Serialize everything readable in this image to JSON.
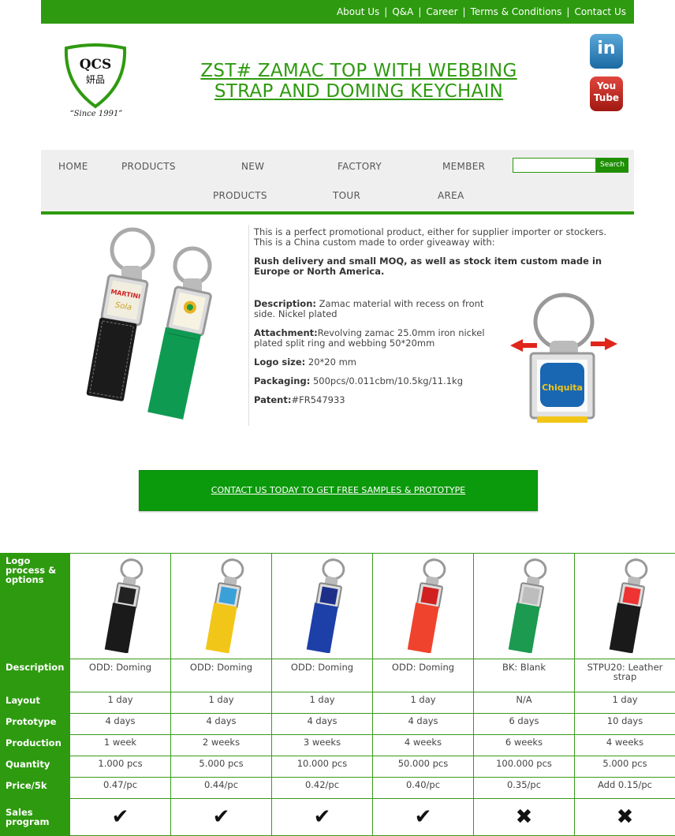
{
  "topnav": {
    "links": [
      "About Us",
      "Q&A",
      "Career",
      "Terms & Conditions",
      "Contact Us"
    ],
    "separator": "|"
  },
  "logo": {
    "text_top": "QCS",
    "text_bottom": "妍品",
    "since": "“Since 1991”"
  },
  "page": {
    "title_line1": "ZST# ZAMAC TOP WITH WEBBING",
    "title_line2": "STRAP AND DOMING KEYCHAIN"
  },
  "social": {
    "linkedin": "in",
    "youtube_line1": "You",
    "youtube_line2": "Tube"
  },
  "mainnav": {
    "home": "HOME",
    "products": "PRODUCTS",
    "new": "NEW",
    "new_products": "PRODUCTS",
    "factory": "FACTORY",
    "factory_tour": "TOUR",
    "member": "MEMBER",
    "member_area": "AREA"
  },
  "search": {
    "value": "",
    "button": "Search"
  },
  "product": {
    "intro": "This is a perfect promotional product, either for supplier importer or stockers. This is a China custom made to order giveaway with:",
    "rush": "Rush delivery and small MOQ, as well as stock item custom made in Europe or North America.",
    "description_label": "Description:",
    "description": " Zamac material with recess on front side. Nickel plated",
    "attachment_label": "Attachment:",
    "attachment": "Revolving zamac 25.0mm iron nickel plated split ring and webbing 50*20mm",
    "logo_size_label": "Logo size:",
    "logo_size": " 20*20 mm",
    "packaging_label": "Packaging:",
    "packaging": " 500pcs/0.011cbm/10.5kg/11.1kg",
    "patent_label": "Patent:",
    "patent": "#FR547933",
    "image1_brand": "MARTINI",
    "image1_script": "Sola",
    "image2_label": "Chiquita"
  },
  "cta": {
    "label": "CONTACT US TODAY TO GET FREE SAMPLES & PROTOTYPE"
  },
  "table": {
    "header_label": "Logo process & options",
    "row_labels": {
      "description": "Description",
      "layout": "Layout",
      "prototype": "Prototype",
      "production": "Production",
      "quantity": "Quantity",
      "price": "Price/5k",
      "sales": "Sales program"
    },
    "columns": [
      {
        "strap_color": "#1a1a1a",
        "head": "#222",
        "description": "ODD: Doming",
        "layout": "1 day",
        "prototype": "4 days",
        "production": "1 week",
        "quantity": "1.000 pcs",
        "price": "0.47/pc",
        "sales": true
      },
      {
        "strap_color": "#f2c618",
        "head": "#3aa0d8",
        "description": "ODD: Doming",
        "layout": "1 day",
        "prototype": "4 days",
        "production": "2 weeks",
        "quantity": "5.000 pcs",
        "price": "0.44/pc",
        "sales": true
      },
      {
        "strap_color": "#1d3fa8",
        "head": "#1d2f88",
        "description": "ODD: Doming",
        "layout": "1 day",
        "prototype": "4 days",
        "production": "3 weeks",
        "quantity": "10.000 pcs",
        "price": "0.42/pc",
        "sales": true
      },
      {
        "strap_color": "#f0432d",
        "head": "#d02020",
        "description": "ODD: Doming",
        "layout": "1 day",
        "prototype": "4 days",
        "production": "4 weeks",
        "quantity": "50.000 pcs",
        "price": "0.40/pc",
        "sales": true
      },
      {
        "strap_color": "#1b9a50",
        "head": "#bdbdbd",
        "description": "BK: Blank",
        "layout": "N/A",
        "prototype": "6 days",
        "production": "6 weeks",
        "quantity": "100.000 pcs",
        "price": "0.35/pc",
        "sales": false
      },
      {
        "strap_color": "#1a1a1a",
        "head": "#e33",
        "description": "STPU20: Leather strap",
        "layout": "1 day",
        "prototype": "10 days",
        "production": "4 weeks",
        "quantity": "5.000 pcs",
        "price": "Add 0.15/pc",
        "sales": false
      }
    ],
    "check": "✔",
    "cross": "✖"
  }
}
